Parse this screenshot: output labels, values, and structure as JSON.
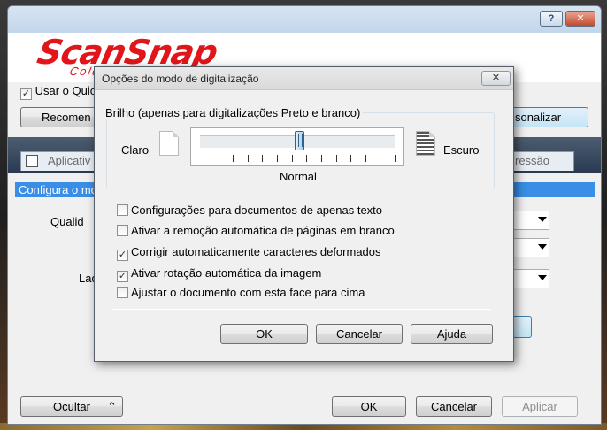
{
  "main_window": {
    "help_button": "?",
    "close_button": "✕",
    "logo": {
      "title": "ScanSnap",
      "subtitle": "Color Image Scanner"
    },
    "quick_menu_checkbox": {
      "label": "Usar o Quic",
      "checked": true
    },
    "recommend_button": "Recomen",
    "customize_button": "sonalizar",
    "tabs": [
      {
        "label": "Aplicativ"
      },
      {
        "label": "ressão"
      }
    ],
    "section_header": "Configura o mo",
    "quality_label": "Qualid",
    "side_label": "Lad",
    "hide_button": "Ocultar",
    "ok_button": "OK",
    "cancel_button": "Cancelar",
    "apply_button": "Aplicar"
  },
  "dialog": {
    "title": "Opções do modo de digitalização",
    "close_glyph": "✕",
    "brightness": {
      "group_label": "Brilho (apenas para digitalizações Preto e branco)",
      "light_label": "Claro",
      "dark_label": "Escuro",
      "value_label": "Normal",
      "level": 0.5,
      "tick_count": 14
    },
    "options": [
      {
        "label": "Configurações para documentos de apenas texto",
        "checked": false
      },
      {
        "label": "Ativar a remoção automática de páginas em branco",
        "checked": false
      },
      {
        "label": "Corrigir automaticamente caracteres deformados",
        "checked": true
      },
      {
        "label": "Ativar rotação automática da imagem",
        "checked": true
      },
      {
        "label": "Ajustar o documento com esta face para cima",
        "checked": false
      }
    ],
    "buttons": {
      "ok": "OK",
      "cancel": "Cancelar",
      "help": "Ajuda"
    }
  },
  "colors": {
    "accent_blue": "#3a8ee6",
    "logo_red": "#e0161b"
  }
}
